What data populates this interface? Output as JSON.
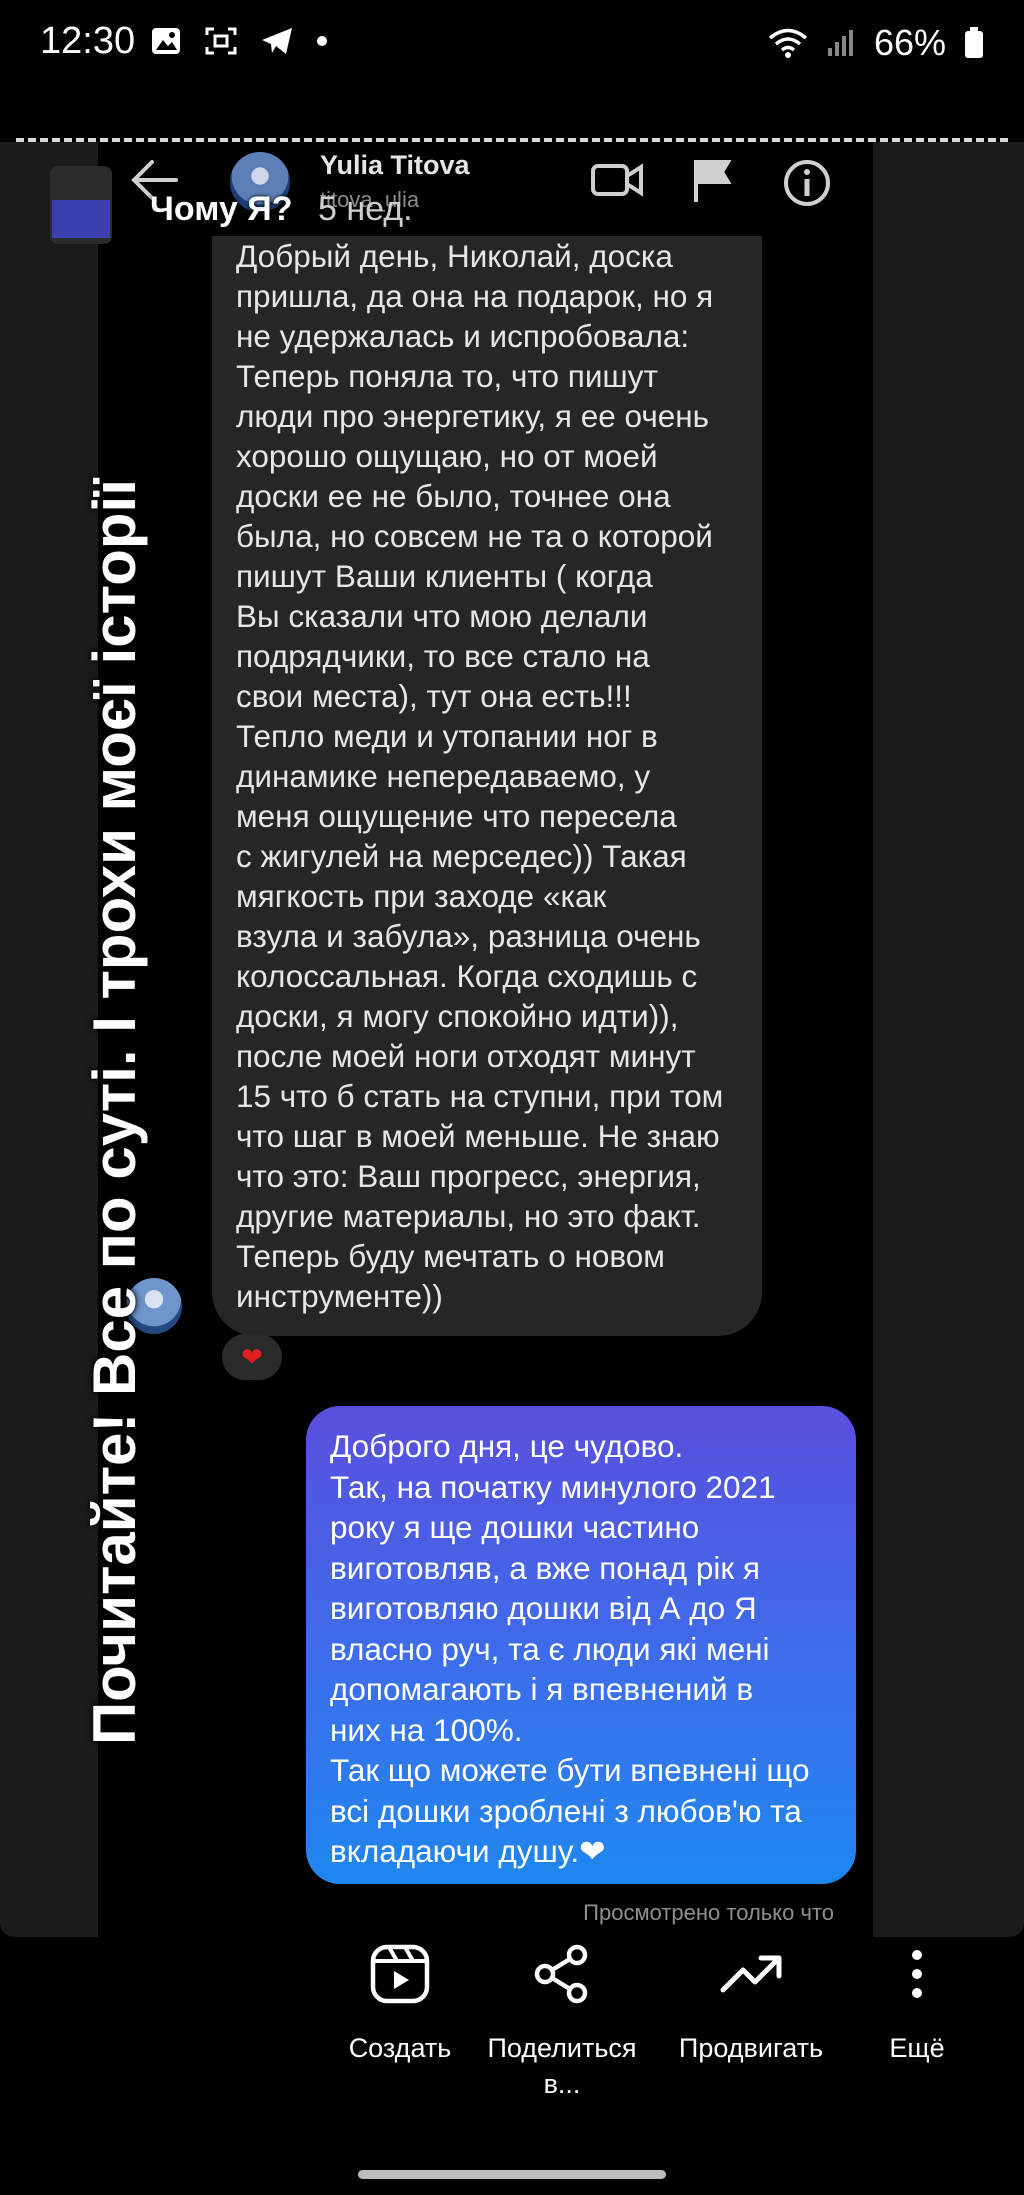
{
  "status_bar": {
    "time": "12:30",
    "battery": "66%",
    "icons": [
      "gallery-icon",
      "screenshot-icon",
      "telegram-icon",
      "dot-icon",
      "wifi-icon",
      "signal-icon",
      "battery-icon"
    ]
  },
  "story": {
    "title": "Чому Я?",
    "time_ago": "5 нед.",
    "overlay_text": "Почитайте!  Все по суті. І трохи моєї історії"
  },
  "chat_header": {
    "name": "Yulia Titova",
    "handle": "titova_ulia",
    "icons": [
      "back-arrow-icon",
      "video-call-icon",
      "flag-icon",
      "info-icon"
    ]
  },
  "received_message": {
    "lines": [
      "Добрый день, Николай, доска",
      "пришла, да она на подарок, но я",
      "не удержалась и испробовала:",
      "Теперь поняла то, что пишут",
      "люди про энергетику, я ее очень",
      "хорошо ощущаю, но от моей",
      "доски ее не было, точнее она",
      "была, но совсем не та о которой",
      "пишут Ваши клиенты ( когда",
      "Вы сказали что мою делали",
      "подрядчики, то все стало на",
      "свои места), тут она есть!!!",
      "Тепло меди и утопании ног в",
      "динамике непередаваемо, у",
      "меня ощущение что пересела",
      "с жигулей на мерседес)) Такая",
      "мягкость при заходе «как",
      "взула и забула», разница очень",
      "колоссальная. Когда сходишь с",
      "доски, я могу спокойно идти)),",
      "после моей ноги отходят минут",
      "15 что б стать на ступни, при том",
      "что шаг в моей меньше. Не знаю",
      "что это: Ваш прогресс, энергия,",
      "другие материалы, но это факт.",
      "Теперь буду мечтать о новом",
      "инструменте))"
    ],
    "reaction": "❤"
  },
  "sent_message": {
    "lines": [
      "Доброго дня, це чудово.",
      "Так, на початку минулого 2021",
      "року я ще дошки частино",
      "виготовляв, а вже понад рік я",
      "виготовляю дошки від А до Я",
      "власно руч, та є люди які мені",
      "допомагають і я впевнений в",
      "них на 100%.",
      "Так що можете бути впевнені що",
      "всі дошки зроблені з любов'ю та",
      "вкладаючи душу.❤"
    ]
  },
  "seen_status": "Просмотрено только что",
  "actions": [
    {
      "label": "Создать",
      "icon": "reels-icon"
    },
    {
      "label": "Поделиться в...",
      "icon": "share-icon"
    },
    {
      "label": "Продвигать",
      "icon": "trend-icon"
    },
    {
      "label": "Ещё",
      "icon": "more-icon"
    }
  ]
}
